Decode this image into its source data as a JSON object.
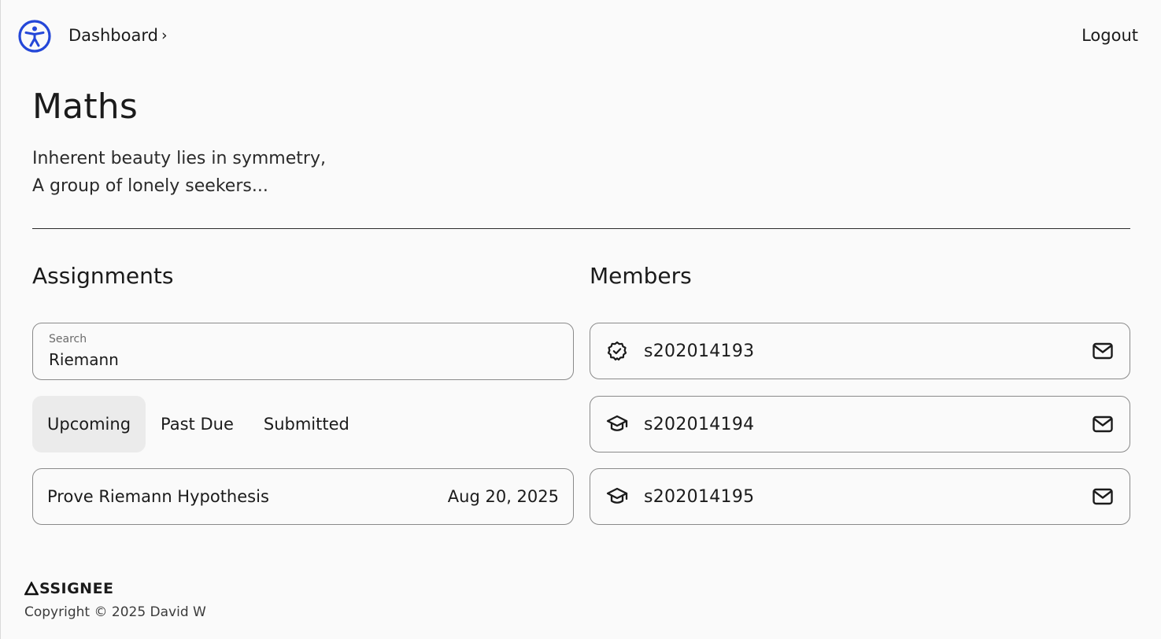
{
  "header": {
    "breadcrumb": "Dashboard",
    "breadcrumb_sep": "›",
    "logout_label": "Logout",
    "accent_color": "#2447d8"
  },
  "course": {
    "title": "Maths",
    "description_line1": "Inherent beauty lies in symmetry,",
    "description_line2": "A group of lonely seekers..."
  },
  "assignments": {
    "heading": "Assignments",
    "search": {
      "label": "Search",
      "value": "Riemann"
    },
    "tabs": [
      {
        "label": "Upcoming",
        "active": true
      },
      {
        "label": "Past Due",
        "active": false
      },
      {
        "label": "Submitted",
        "active": false
      }
    ],
    "items": [
      {
        "title": "Prove Riemann Hypothesis",
        "due": "Aug 20, 2025"
      }
    ]
  },
  "members": {
    "heading": "Members",
    "items": [
      {
        "id": "s202014193",
        "role_icon": "verified-badge-icon"
      },
      {
        "id": "s202014194",
        "role_icon": "graduation-cap-icon"
      },
      {
        "id": "s202014195",
        "role_icon": "graduation-cap-icon"
      }
    ],
    "mail_icon": "mail-icon"
  },
  "footer": {
    "brand": "SSIGNEE",
    "copyright": "Copyright © 2025 David W"
  }
}
